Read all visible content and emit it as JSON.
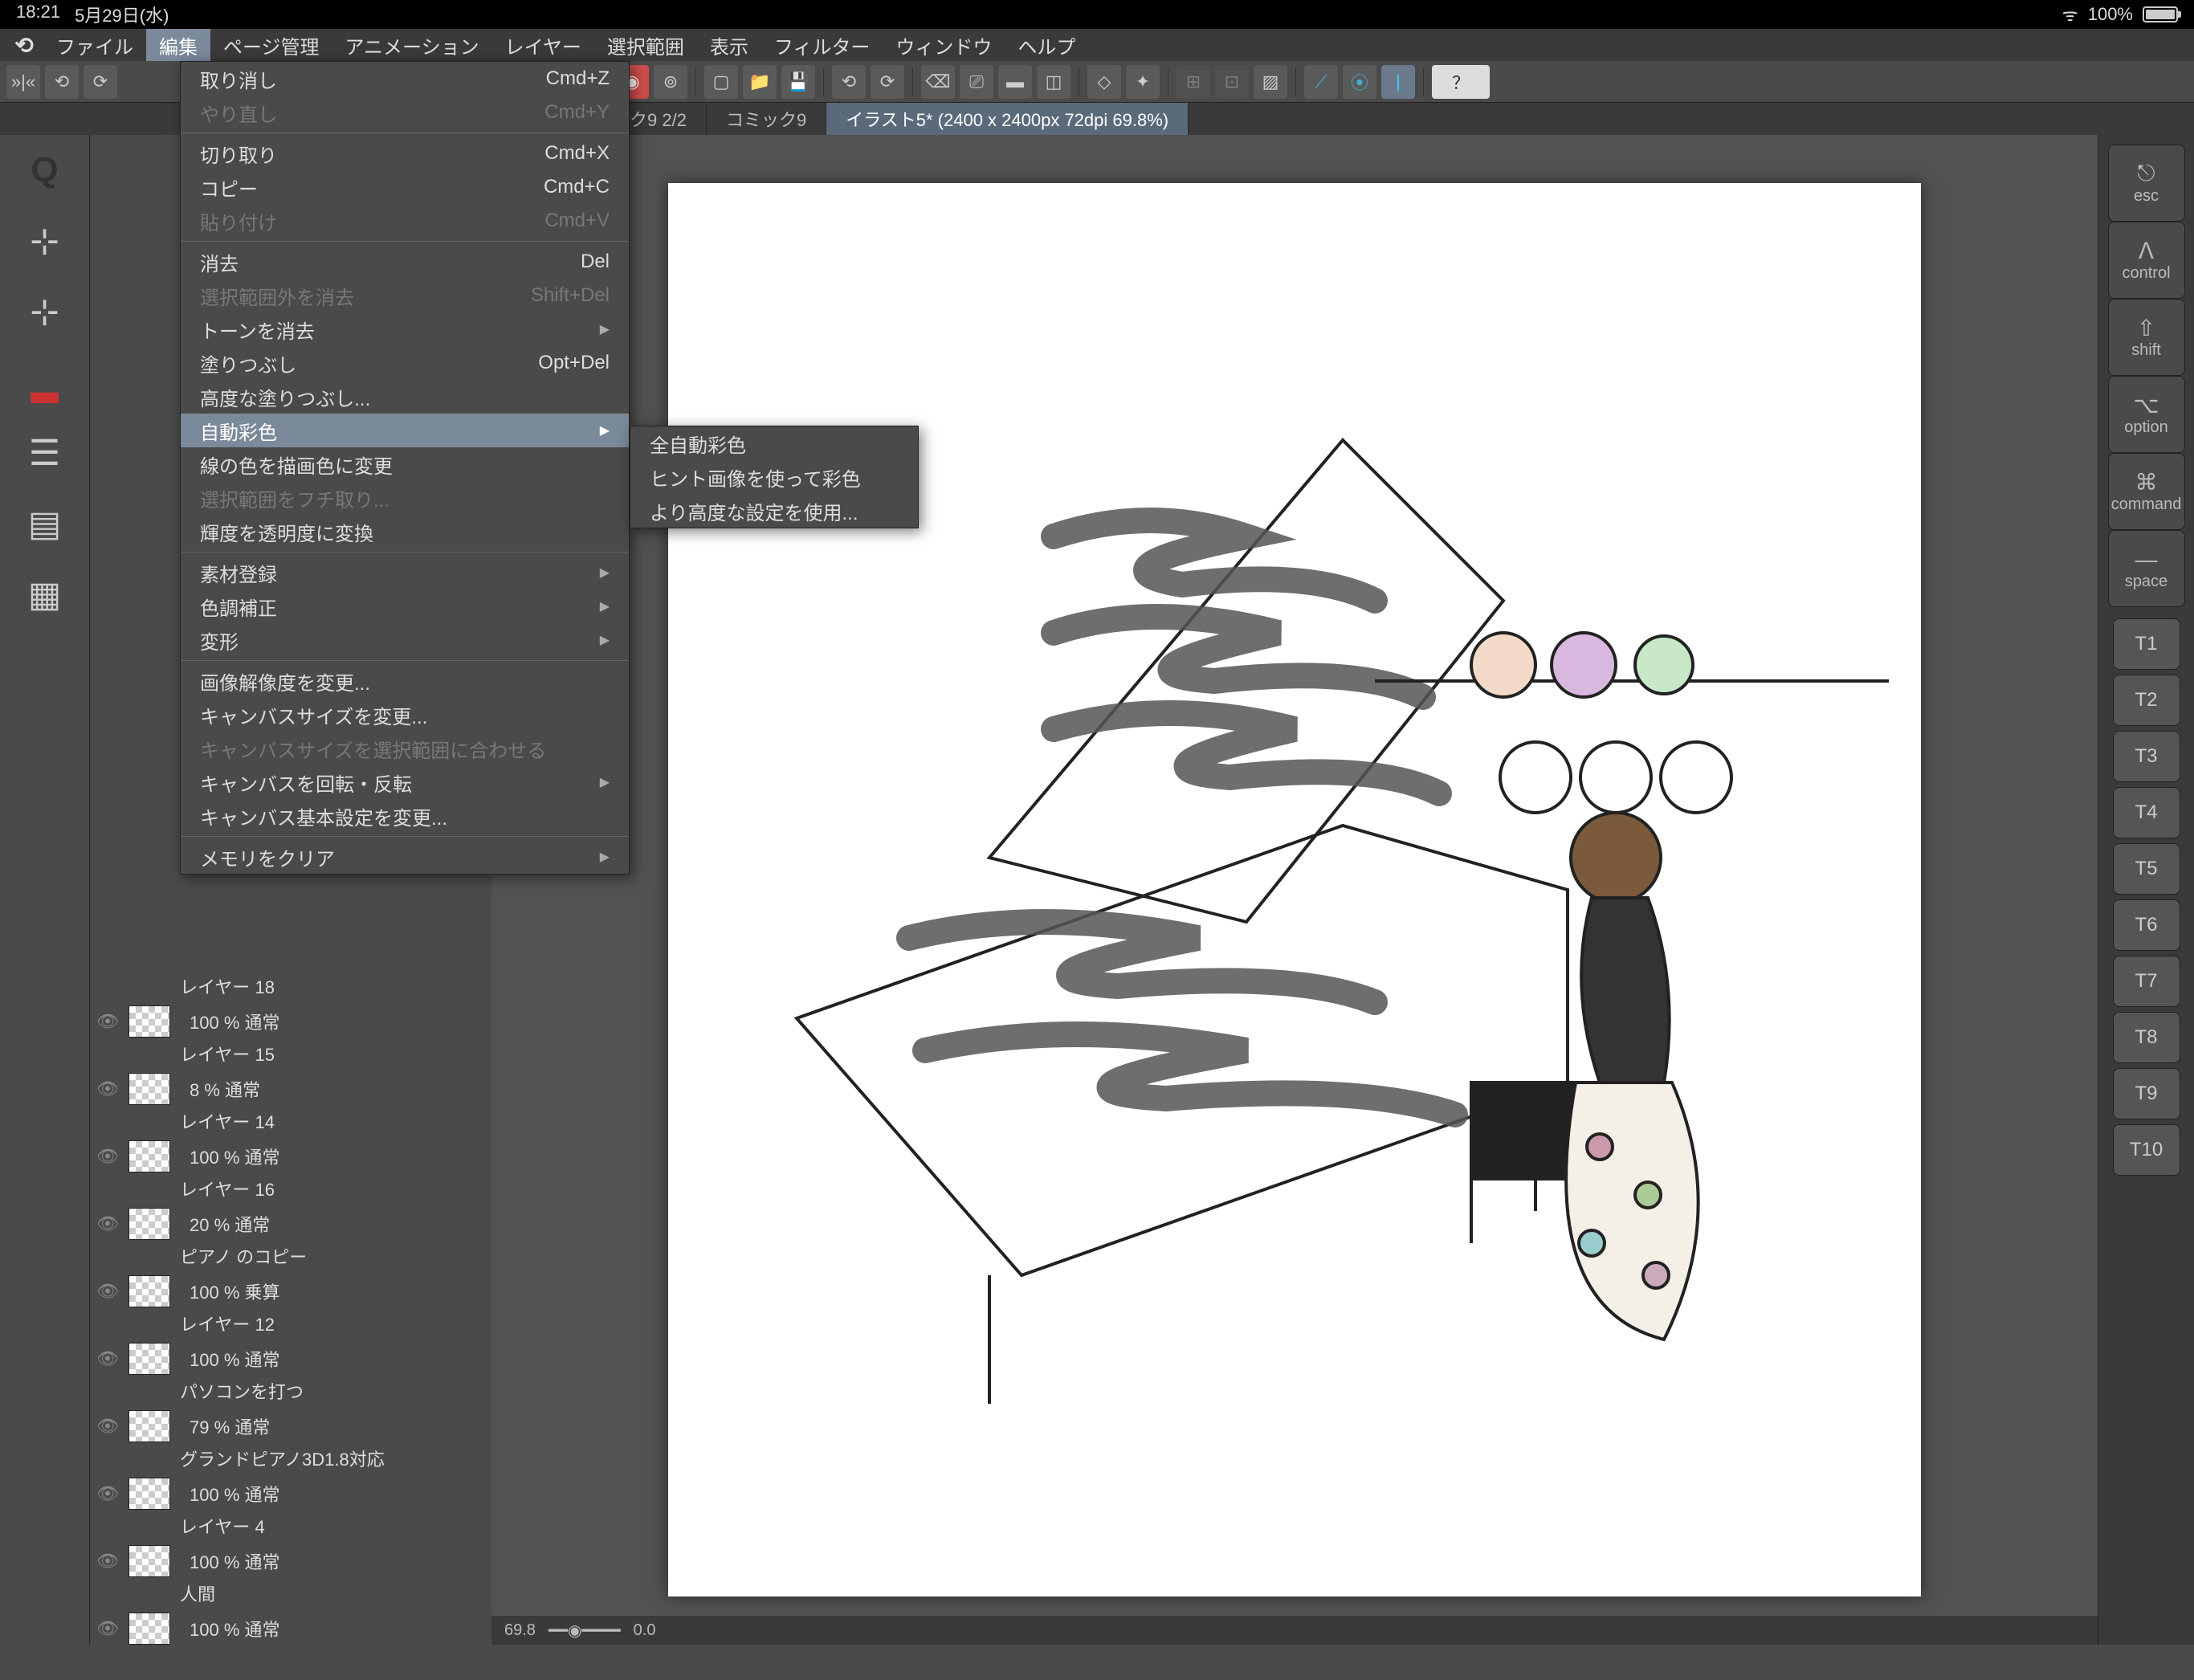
{
  "status": {
    "time": "18:21",
    "date": "5月29日(水)",
    "battery": "100%"
  },
  "menubar": {
    "items": [
      "ファイル",
      "編集",
      "ページ管理",
      "アニメーション",
      "レイヤー",
      "選択範囲",
      "表示",
      "フィルター",
      "ウィンドウ",
      "ヘルプ"
    ],
    "active_index": 1
  },
  "tabs": {
    "items": [
      "ク9 2/2",
      "コミック9",
      "イラスト5* (2400 x 2400px 72dpi 69.8%)"
    ],
    "active_index": 2
  },
  "dropdown": {
    "groups": [
      [
        {
          "label": "取り消し",
          "shortcut": "Cmd+Z",
          "enabled": true
        },
        {
          "label": "やり直し",
          "shortcut": "Cmd+Y",
          "enabled": false
        }
      ],
      [
        {
          "label": "切り取り",
          "shortcut": "Cmd+X",
          "enabled": true
        },
        {
          "label": "コピー",
          "shortcut": "Cmd+C",
          "enabled": true
        },
        {
          "label": "貼り付け",
          "shortcut": "Cmd+V",
          "enabled": false
        }
      ],
      [
        {
          "label": "消去",
          "shortcut": "Del",
          "enabled": true
        },
        {
          "label": "選択範囲外を消去",
          "shortcut": "Shift+Del",
          "enabled": false
        },
        {
          "label": "トーンを消去",
          "shortcut": "",
          "enabled": true,
          "arrow": true
        },
        {
          "label": "塗りつぶし",
          "shortcut": "Opt+Del",
          "enabled": true
        },
        {
          "label": "高度な塗りつぶし...",
          "shortcut": "",
          "enabled": true
        },
        {
          "label": "自動彩色",
          "shortcut": "",
          "enabled": true,
          "arrow": true,
          "hover": true
        },
        {
          "label": "線の色を描画色に変更",
          "shortcut": "",
          "enabled": true
        },
        {
          "label": "選択範囲をフチ取り...",
          "shortcut": "",
          "enabled": false
        },
        {
          "label": "輝度を透明度に変換",
          "shortcut": "",
          "enabled": true
        }
      ],
      [
        {
          "label": "素材登録",
          "shortcut": "",
          "enabled": true,
          "arrow": true
        },
        {
          "label": "色調補正",
          "shortcut": "",
          "enabled": true,
          "arrow": true
        },
        {
          "label": "変形",
          "shortcut": "",
          "enabled": true,
          "arrow": true
        }
      ],
      [
        {
          "label": "画像解像度を変更...",
          "shortcut": "",
          "enabled": true
        },
        {
          "label": "キャンバスサイズを変更...",
          "shortcut": "",
          "enabled": true
        },
        {
          "label": "キャンバスサイズを選択範囲に合わせる",
          "shortcut": "",
          "enabled": false
        },
        {
          "label": "キャンバスを回転・反転",
          "shortcut": "",
          "enabled": true,
          "arrow": true
        },
        {
          "label": "キャンバス基本設定を変更...",
          "shortcut": "",
          "enabled": true
        }
      ],
      [
        {
          "label": "メモリをクリア",
          "shortcut": "",
          "enabled": true,
          "arrow": true
        }
      ]
    ]
  },
  "submenu": {
    "items": [
      "全自動彩色",
      "ヒント画像を使って彩色",
      "より高度な設定を使用..."
    ]
  },
  "layers": [
    {
      "opacity": "",
      "name": "レイヤー 18"
    },
    {
      "opacity": "100 % 通常",
      "name": "レイヤー 15"
    },
    {
      "opacity": "8 % 通常",
      "name": "レイヤー 14"
    },
    {
      "opacity": "100 % 通常",
      "name": "レイヤー 16"
    },
    {
      "opacity": "20 % 通常",
      "name": "ピアノ のコピー"
    },
    {
      "opacity": "100 % 乗算",
      "name": "レイヤー 12"
    },
    {
      "opacity": "100 % 通常",
      "name": "パソコンを打つ"
    },
    {
      "opacity": "79 % 通常",
      "name": "グランドピアノ3D1.8対応"
    },
    {
      "opacity": "100 % 通常",
      "name": "レイヤー 4"
    },
    {
      "opacity": "100 % 通常",
      "name": "人間"
    },
    {
      "opacity": "100 % 通常",
      "name": ""
    }
  ],
  "right_keys": {
    "modifiers": [
      {
        "sym": "⎋",
        "label": "esc"
      },
      {
        "sym": "ᐱ",
        "label": "control"
      },
      {
        "sym": "⇧",
        "label": "shift"
      },
      {
        "sym": "⌥",
        "label": "option"
      },
      {
        "sym": "⌘",
        "label": "command"
      },
      {
        "sym": "—",
        "label": "space"
      }
    ],
    "t_keys": [
      "T1",
      "T2",
      "T3",
      "T4",
      "T5",
      "T6",
      "T7",
      "T8",
      "T9",
      "T10"
    ]
  },
  "bottom": {
    "zoom": "69.8",
    "angle": "0.0"
  }
}
